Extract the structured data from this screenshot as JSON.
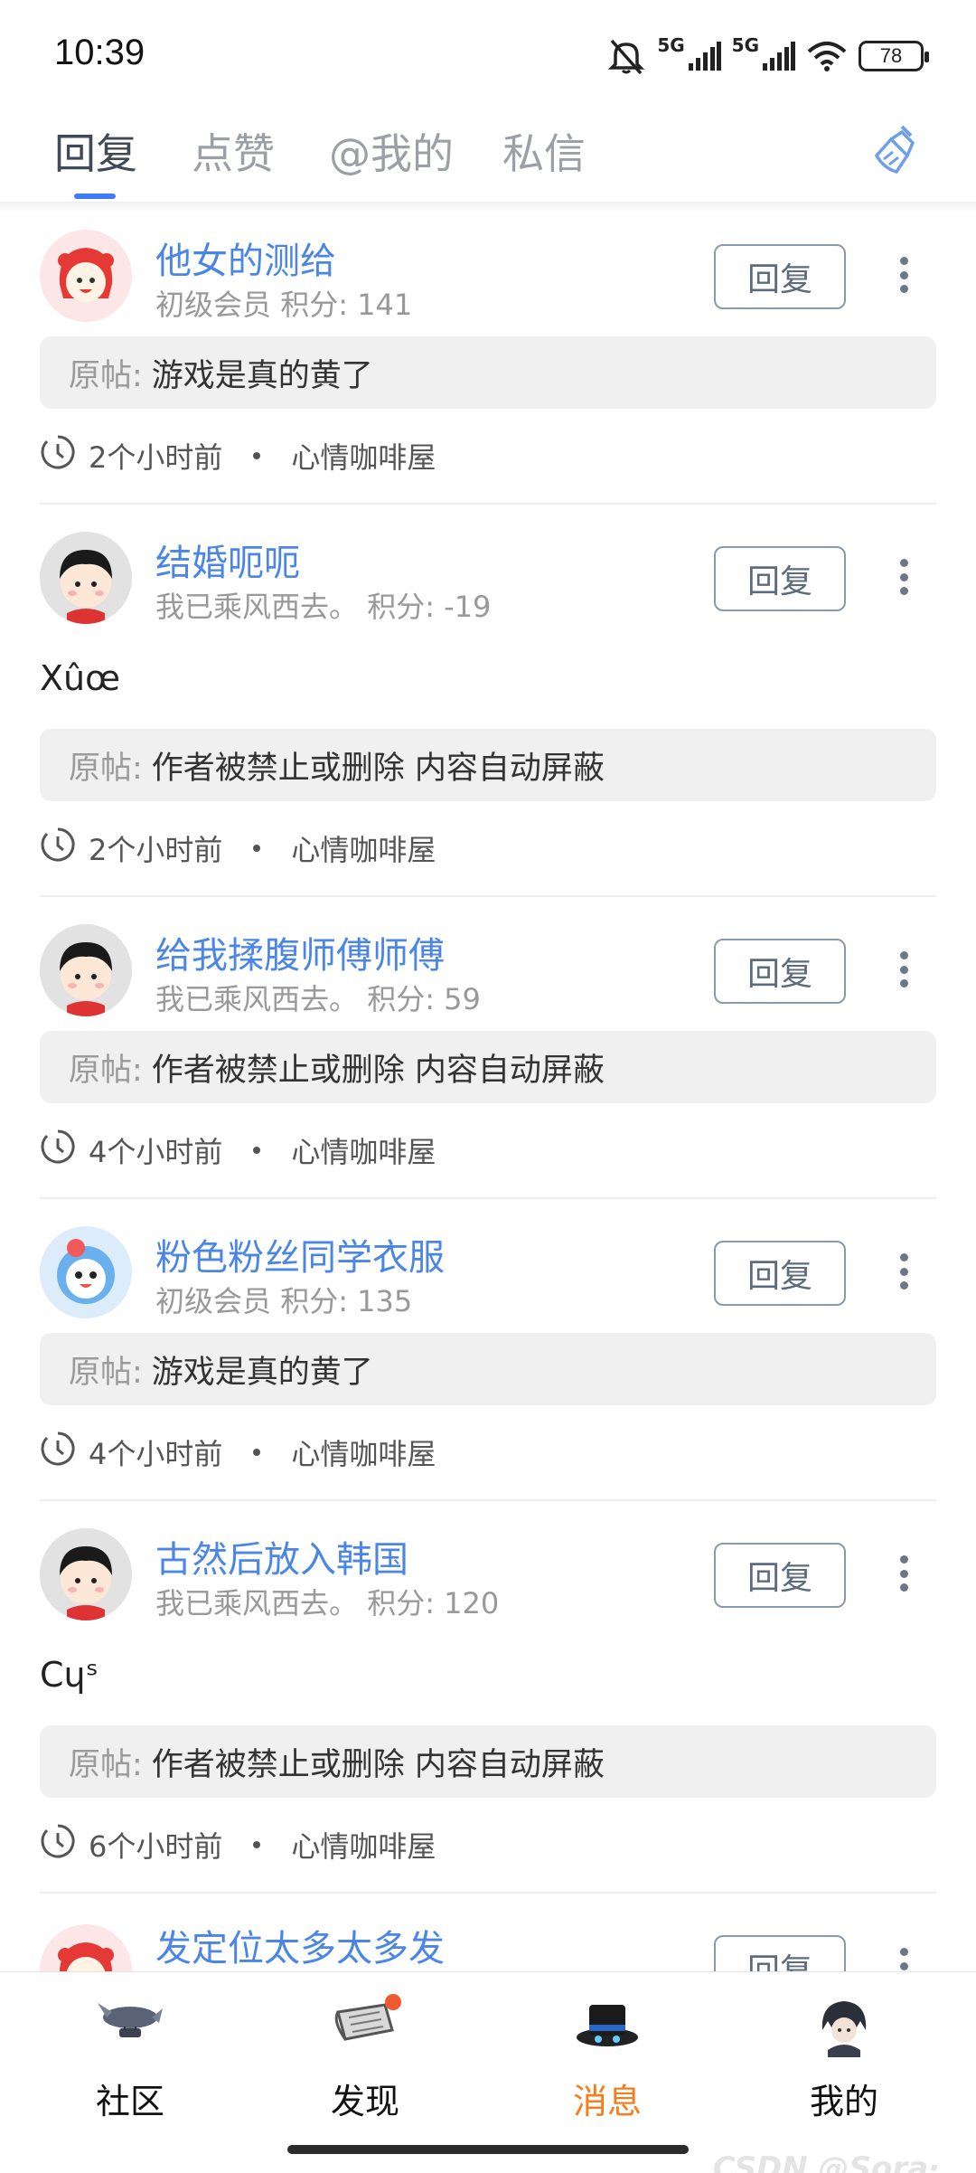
{
  "status_bar": {
    "time": "10:39",
    "network_1": "5G",
    "network_2": "5G",
    "battery": "78",
    "icons": [
      "mute-bell-icon",
      "signal-icon",
      "signal-icon",
      "wifi-icon",
      "battery-icon"
    ]
  },
  "tabs": [
    {
      "label": "回复",
      "active": true
    },
    {
      "label": "点赞",
      "active": false
    },
    {
      "label": "@我的",
      "active": false
    },
    {
      "label": "私信",
      "active": false
    }
  ],
  "clean_icon": "broom-icon",
  "reply_label": "回复",
  "orig_label": "原帖:",
  "items": [
    {
      "username": "他女的测给",
      "level": "初级会员",
      "points": "积分: 141",
      "content": "",
      "orig": "游戏是真的黄了",
      "time": "2个小时前",
      "forum": "心情咖啡屋",
      "avatar": "red-hood-avatar"
    },
    {
      "username": "结婚呃呃",
      "level": "我已乘风西去。",
      "points": "积分: -19",
      "content": "Χûœ",
      "orig": "作者被禁止或删除 内容自动屏蔽",
      "time": "2个小时前",
      "forum": "心情咖啡屋",
      "avatar": "black-hair-avatar"
    },
    {
      "username": "给我揉腹师傅师傅",
      "level": "我已乘风西去。",
      "points": "积分: 59",
      "content": "",
      "orig": "作者被禁止或删除 内容自动屏蔽",
      "time": "4个小时前",
      "forum": "心情咖啡屋",
      "avatar": "black-hair-avatar"
    },
    {
      "username": "粉色粉丝同学衣服",
      "level": "初级会员",
      "points": "积分: 135",
      "content": "",
      "orig": "游戏是真的黄了",
      "time": "4个小时前",
      "forum": "心情咖啡屋",
      "avatar": "blue-mascot-avatar"
    },
    {
      "username": "古然后放入韩国",
      "level": "我已乘风西去。",
      "points": "积分: 120",
      "content": "Cɥˢ",
      "orig": "作者被禁止或删除 内容自动屏蔽",
      "time": "6个小时前",
      "forum": "心情咖啡屋",
      "avatar": "black-hair-avatar"
    },
    {
      "username": "发定位太多太多发",
      "level": "",
      "points": "",
      "content": "",
      "orig": "",
      "time": "",
      "forum": "",
      "avatar": "red-hood-avatar"
    }
  ],
  "bottom_nav": [
    {
      "label": "社区",
      "icon": "airship-icon",
      "active": false
    },
    {
      "label": "发现",
      "icon": "scroll-icon",
      "active": false,
      "badge": true
    },
    {
      "label": "消息",
      "icon": "top-hat-icon",
      "active": true
    },
    {
      "label": "我的",
      "icon": "character-icon",
      "active": false
    }
  ],
  "watermark": "CSDN @Sora·",
  "colors": {
    "accent": "#4b86e6",
    "tab_indicator": "#3d7cf4",
    "active_nav": "#f77c1b",
    "badge": "#f15a2c"
  }
}
